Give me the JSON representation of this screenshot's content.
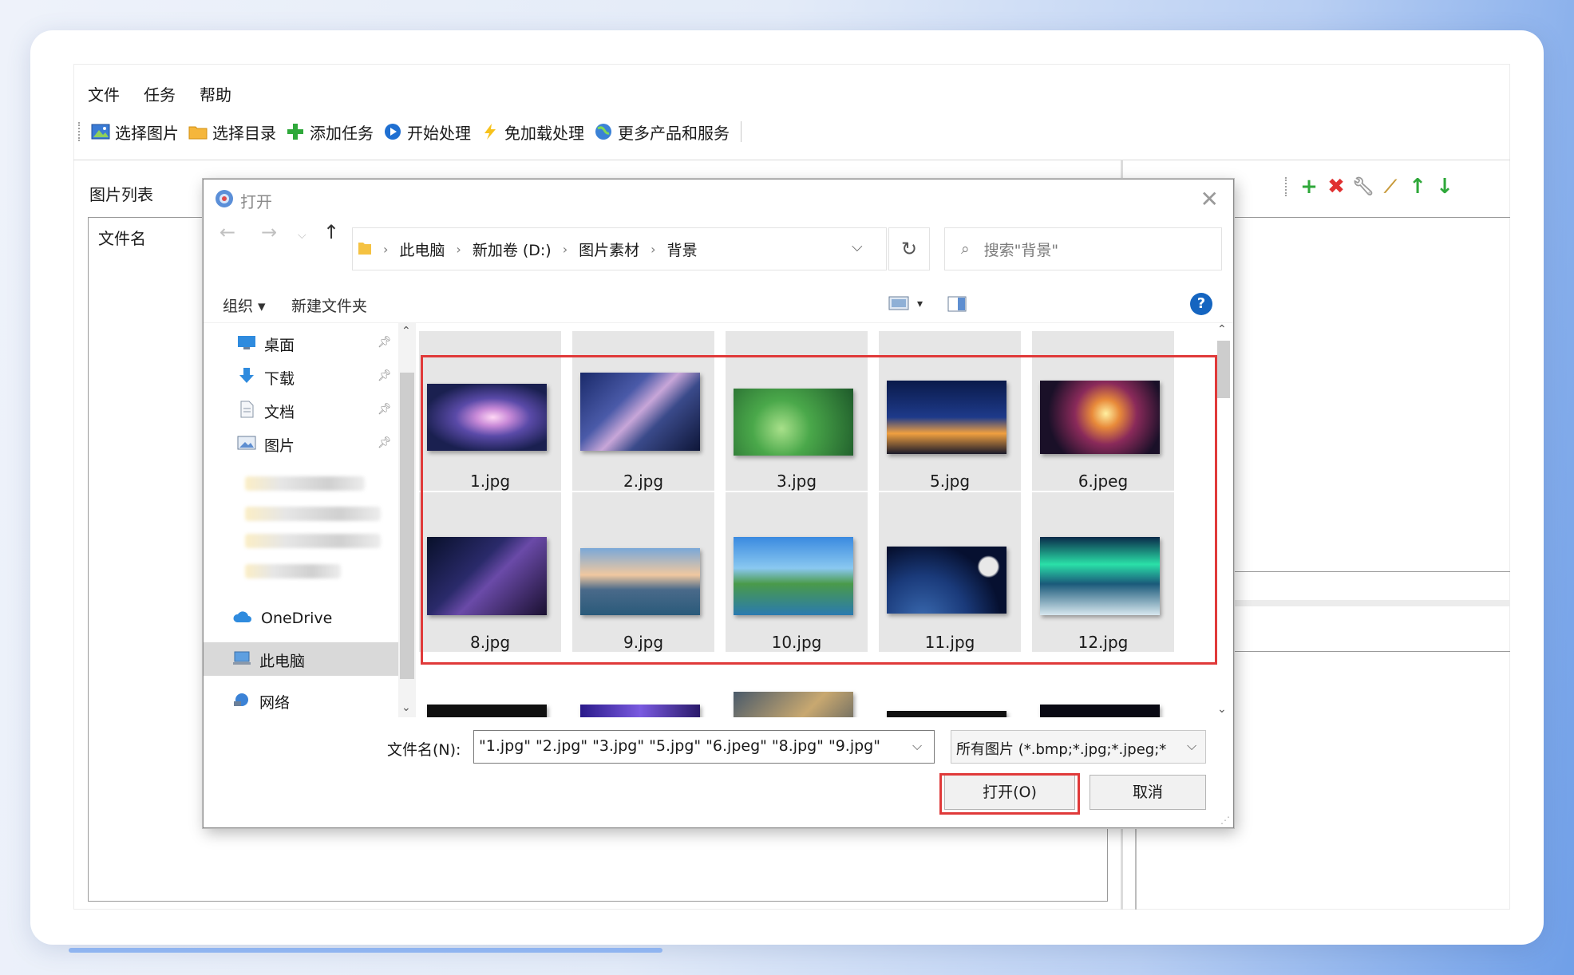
{
  "app": {
    "menu": [
      "文件",
      "任务",
      "帮助"
    ],
    "toolbar": [
      {
        "label": "选择图片",
        "icon": "image-icon"
      },
      {
        "label": "选择目录",
        "icon": "folder-icon"
      },
      {
        "label": "添加任务",
        "icon": "plus-icon"
      },
      {
        "label": "开始处理",
        "icon": "play-icon"
      },
      {
        "label": "免加载处理",
        "icon": "lightning-icon"
      },
      {
        "label": "更多产品和服务",
        "icon": "globe-icon"
      }
    ],
    "list_title": "图片列表",
    "list_column": "文件名",
    "right_panel_tools": [
      "add-icon",
      "delete-icon",
      "wrench-icon",
      "broom-icon",
      "arrow-up-icon",
      "arrow-down-icon"
    ]
  },
  "dialog": {
    "title": "打开",
    "address": [
      "此电脑",
      "新加卷 (D:)",
      "图片素材",
      "背景"
    ],
    "search_placeholder": "搜索\"背景\"",
    "organize": "组织 ▾",
    "new_folder": "新建文件夹",
    "help": "?",
    "nav_items": [
      {
        "label": "桌面"
      },
      {
        "label": "下载"
      },
      {
        "label": "文档"
      },
      {
        "label": "图片"
      },
      {
        "label": "OneDrive"
      },
      {
        "label": "此电脑"
      },
      {
        "label": "网络"
      }
    ],
    "files_row1": [
      "1.jpg",
      "2.jpg",
      "3.jpg",
      "5.jpg",
      "6.jpeg"
    ],
    "files_row2": [
      "8.jpg",
      "9.jpg",
      "10.jpg",
      "11.jpg",
      "12.jpg"
    ],
    "filename_label": "文件名(N):",
    "filename_value": "\"1.jpg\" \"2.jpg\" \"3.jpg\" \"5.jpg\" \"6.jpeg\" \"8.jpg\" \"9.jpg\"",
    "filetype_value": "所有图片 (*.bmp;*.jpg;*.jpeg;*",
    "open_button": "打开(O)",
    "cancel_button": "取消"
  },
  "colors": {
    "highlight": "#e03a3a",
    "accent": "#1565c0"
  }
}
